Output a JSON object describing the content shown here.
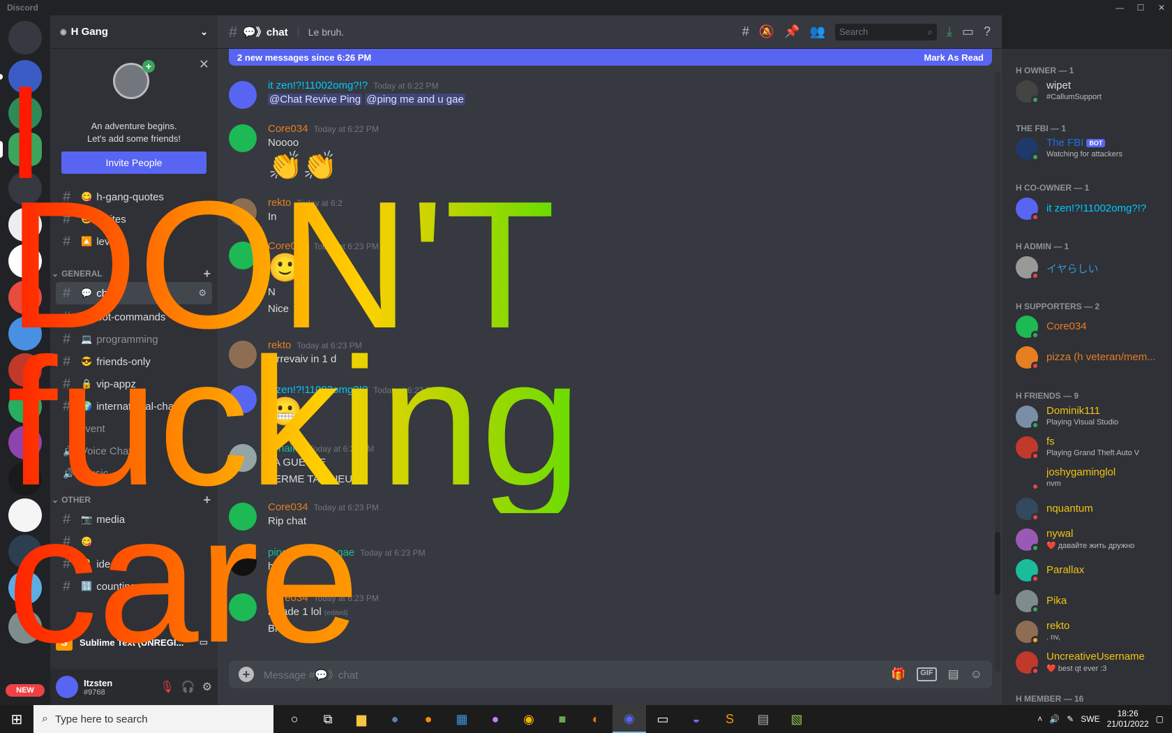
{
  "window": {
    "app_name": "Discord"
  },
  "guild": {
    "name": "H Gang"
  },
  "invite_card": {
    "line1": "An adventure begins.",
    "line2": "Let's add some friends!",
    "button": "Invite People"
  },
  "channels": [
    {
      "name": "h-gang-quotes",
      "emoji": "😋"
    },
    {
      "name": "invites",
      "emoji": "😃"
    },
    {
      "name": "level",
      "emoji": "🔼"
    }
  ],
  "categories": {
    "general": "GENERAL",
    "other": "OTHER"
  },
  "general_channels": [
    {
      "name": "chat",
      "emoji": "💬",
      "active": true
    },
    {
      "name": "bot-commands",
      "emoji": "🤖"
    },
    {
      "name": "programming",
      "emoji": "💻"
    },
    {
      "name": "friends-only",
      "emoji": "😎"
    },
    {
      "name": "vip-appz",
      "emoji": "🔒"
    },
    {
      "name": "international-chat",
      "emoji": "🌍"
    },
    {
      "name": "event",
      "emoji": ""
    },
    {
      "name": "Voice Chat",
      "emoji": "",
      "voice": true
    },
    {
      "name": "Music",
      "emoji": "",
      "voice": true
    }
  ],
  "other_channels": [
    {
      "name": "media",
      "emoji": "📷"
    },
    {
      "name": "",
      "emoji": "😋"
    },
    {
      "name": "ideas",
      "emoji": "💡"
    },
    {
      "name": "counting",
      "emoji": "🔢"
    }
  ],
  "stream_bar": {
    "label": "Sublime Text (UNREGI..."
  },
  "user": {
    "name": "Itzsten",
    "tag": "#9768"
  },
  "header": {
    "channel": "💬》chat",
    "topic": "Le bruh.",
    "search_placeholder": "Search"
  },
  "banner": {
    "text": "2 new messages since 6:26 PM",
    "action": "Mark As Read"
  },
  "messages": [
    {
      "author": "it zen!?!11002omg?!?",
      "color": "#00c8ff",
      "time": "Today at 6:22 PM",
      "lines": [],
      "mentions": [
        "@Chat Revive Ping",
        "@ping me and u gae"
      ]
    },
    {
      "author": "Core034",
      "color": "#e67e22",
      "time": "Today at 6:22 PM",
      "lines": [
        "Noooo"
      ],
      "emoji": "👏👏"
    },
    {
      "author": "rekto",
      "color": "#e67e22",
      "time": "Today at 6:2",
      "lines": [
        "In"
      ]
    },
    {
      "author": "Core034",
      "color": "#e67e22",
      "time": "Today at 6:23 PM",
      "lines": [
        "N",
        "Nice"
      ],
      "emoji": "🙂"
    },
    {
      "author": "rekto",
      "color": "#e67e22",
      "time": "Today at 6:23 PM",
      "lines": [
        "3 rrevaiv in 1 d"
      ]
    },
    {
      "author": "it zen!?!11002omg?!?",
      "color": "#00c8ff",
      "time": "Today at 6:23 PM",
      "lines": [],
      "emoji": "😬"
    },
    {
      "author": "Arnaika",
      "color": "#1abc9c",
      "time": "Today at 6:23 PM",
      "lines": [
        "TA GUEULE",
        "FERME TA GUEULE"
      ]
    },
    {
      "author": "Core034",
      "color": "#e67e22",
      "time": "Today at 6:23 PM",
      "lines": [
        "Rip chat"
      ]
    },
    {
      "author": "ping me and u gae",
      "color": "#1abc9c",
      "time": "Today at 6:23 PM",
      "lines": [
        "h"
      ]
    },
    {
      "author": "Core034",
      "color": "#e67e22",
      "time": "Today at 6:23 PM",
      "lines": [
        "i made 1 lol",
        "Bruh"
      ],
      "edited": "(edited)"
    }
  ],
  "composer": {
    "placeholder": "Message #💬》chat"
  },
  "member_groups": [
    {
      "role": "H OWNER — 1",
      "members": [
        {
          "name": "wipet",
          "sub": "#CallumSupport",
          "color": "#dcddde"
        }
      ]
    },
    {
      "role": "THE FBI — 1",
      "members": [
        {
          "name": "The FBI",
          "sub": "Watching for attackers",
          "color": "#1f6feb",
          "bot": "BOT"
        }
      ]
    },
    {
      "role": "H CO-OWNER — 1",
      "members": [
        {
          "name": "it zen!?!11002omg?!?",
          "sub": "",
          "color": "#00c8ff"
        }
      ]
    },
    {
      "role": "H ADMIN — 1",
      "members": [
        {
          "name": "イヤらしい",
          "sub": "",
          "color": "#3498db"
        }
      ]
    },
    {
      "role": "H SUPPORTERS — 2",
      "members": [
        {
          "name": "Core034",
          "sub": "",
          "color": "#e67e22"
        },
        {
          "name": "pizza (h veteran/mem...",
          "sub": "",
          "color": "#e67e22"
        }
      ]
    },
    {
      "role": "H FRIENDS — 9",
      "members": [
        {
          "name": "Dominik111",
          "sub": "Playing Visual Studio",
          "color": "#f1c40f"
        },
        {
          "name": "fs",
          "sub": "Playing Grand Theft Auto V",
          "color": "#f1c40f"
        },
        {
          "name": "joshygaminglol",
          "sub": "nvm",
          "color": "#f1c40f"
        },
        {
          "name": "nquantum",
          "sub": "",
          "color": "#f1c40f"
        },
        {
          "name": "nywal",
          "sub": "❤️ давайте жить дружно",
          "color": "#f1c40f"
        },
        {
          "name": "Parallax",
          "sub": "",
          "color": "#f1c40f"
        },
        {
          "name": "Pika",
          "sub": "",
          "color": "#f1c40f"
        },
        {
          "name": "rekto",
          "sub": ". nv,",
          "color": "#f1c40f"
        },
        {
          "name": "UncreativeUsername",
          "sub": "❤️ best qt ever :3",
          "color": "#f1c40f"
        }
      ]
    },
    {
      "role": "H MEMBER — 16",
      "members": []
    }
  ],
  "overlay_text": {
    "line1": "I",
    "line2": "DON'T",
    "line3": "fucking",
    "line4": "care"
  },
  "server_badge": "NEW",
  "taskbar": {
    "search_placeholder": "Type here to search",
    "lang": "SWE",
    "time": "18:26",
    "date": "21/01/2022"
  }
}
